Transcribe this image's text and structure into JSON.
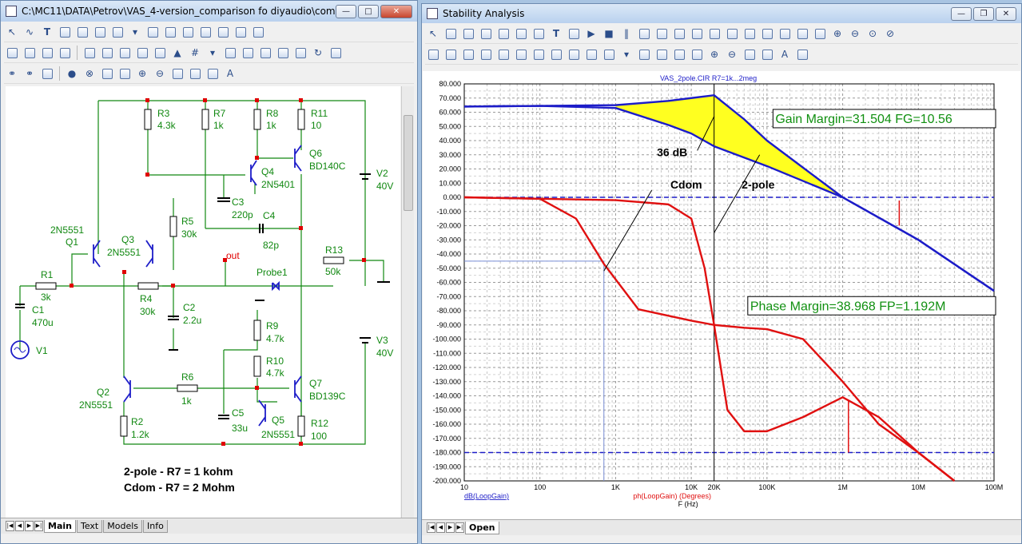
{
  "schematic_window": {
    "title": "C:\\MC11\\DATA\\Petrov\\VAS_4-version_comparison fo diyaudio\\compari...",
    "tabs": [
      "Main",
      "Text",
      "Models",
      "Info"
    ],
    "note_line1": "2-pole - R7 = 1 kohm",
    "note_line2": "Cdom - R7 = 2 Mohm",
    "components": {
      "R3": [
        "R3",
        "4.3k"
      ],
      "R7": [
        "R7",
        "1k"
      ],
      "R8": [
        "R8",
        "1k"
      ],
      "R11": [
        "R11",
        "10"
      ],
      "Q6": [
        "Q6",
        "BD140C"
      ],
      "Q4": [
        "Q4",
        "2N5401"
      ],
      "C3": [
        "C3",
        "220p"
      ],
      "C4": [
        "C4",
        "82p"
      ],
      "V2": [
        "V2",
        "40V"
      ],
      "R5": [
        "R5",
        "30k"
      ],
      "Q1": [
        "2N5551",
        "Q1"
      ],
      "Q3": [
        "Q3",
        "2N5551"
      ],
      "R13": [
        "R13",
        "50k"
      ],
      "out": "out",
      "Probe1": "Probe1",
      "R1": [
        "R1",
        "3k"
      ],
      "C1": [
        "C1",
        "470u"
      ],
      "R4": [
        "R4",
        "30k"
      ],
      "C2": [
        "C2",
        "2.2u"
      ],
      "V1": "V1",
      "R9": [
        "R9",
        "4.7k"
      ],
      "R10": [
        "R10",
        "4.7k"
      ],
      "V3": [
        "V3",
        "40V"
      ],
      "R6": [
        "R6",
        "1k"
      ],
      "Q7": [
        "Q7",
        "BD139C"
      ],
      "Q2": [
        "Q2",
        "2N5551"
      ],
      "R2": [
        "R2",
        "1.2k"
      ],
      "C5": [
        "C5",
        "33u"
      ],
      "Q5": [
        "Q5",
        "2N5551"
      ],
      "R12": [
        "R12",
        "100"
      ]
    }
  },
  "stability_window": {
    "title": "Stability Analysis",
    "tabs": [
      "Open"
    ],
    "plot_title": "VAS_2pole.CIR R7=1k...2meg",
    "gain_margin": "Gain Margin=31.504 FG=10.56",
    "phase_margin": "Phase Margin=38.968 FP=1.192M",
    "ann_36db": "36 dB",
    "ann_cdom": "Cdom",
    "ann_2pole": "2-pole",
    "legend_db": "dB(LoopGain)",
    "legend_ph": "ph(LoopGain) (Degrees)",
    "x_axis_label": "F (Hz)"
  },
  "chart_data": {
    "type": "line",
    "x_scale": "log",
    "xlim": [
      10,
      100000000
    ],
    "x_ticks": [
      "10",
      "100",
      "1K",
      "10K",
      "20K",
      "100K",
      "1M",
      "10M",
      "100M"
    ],
    "ylim": [
      -200,
      80
    ],
    "y_ticks": [
      "80.000",
      "70.000",
      "60.000",
      "50.000",
      "40.000",
      "30.000",
      "20.000",
      "10.000",
      "0.000",
      "-10.000",
      "-20.000",
      "-30.000",
      "-40.000",
      "-50.000",
      "-60.000",
      "-70.000",
      "-80.000",
      "-90.000",
      "-100.000",
      "-110.000",
      "-120.000",
      "-130.000",
      "-140.000",
      "-150.000",
      "-160.000",
      "-170.000",
      "-180.000",
      "-190.000",
      "-200.000"
    ],
    "series": [
      {
        "name": "dB(LoopGain) 2-pole",
        "color": "#1c1cc8",
        "x": [
          10,
          100,
          1000,
          5000,
          10000,
          20000,
          50000,
          100000,
          1000000,
          10000000,
          100000000
        ],
        "y": [
          64,
          64.5,
          65,
          68,
          70,
          72,
          55,
          40,
          0,
          -30,
          -66
        ]
      },
      {
        "name": "dB(LoopGain) Cdom",
        "color": "#1c1cc8",
        "x": [
          10,
          100,
          1000,
          5000,
          10000,
          20000,
          100000,
          1000000,
          10000000,
          100000000
        ],
        "y": [
          64,
          64.5,
          63,
          51,
          45,
          36,
          22,
          0,
          -30,
          -66
        ]
      },
      {
        "name": "ph(LoopGain) Cdom",
        "color": "#e01010",
        "x": [
          10,
          100,
          300,
          700,
          2000,
          10000,
          20000,
          50000,
          100000,
          300000,
          1000000,
          3000000,
          10000000,
          30000000
        ],
        "y": [
          0,
          -1,
          -15,
          -47,
          -79,
          -87,
          -90,
          -92,
          -93,
          -100,
          -130,
          -160,
          -180,
          -200
        ]
      },
      {
        "name": "ph(LoopGain) 2-pole",
        "color": "#e01010",
        "x": [
          10,
          100,
          1000,
          5000,
          10000,
          15000,
          20000,
          30000,
          50000,
          100000,
          300000,
          1000000,
          3000000,
          10000000,
          30000000
        ],
        "y": [
          0,
          -1,
          -2,
          -5,
          -15,
          -50,
          -90,
          -150,
          -165,
          -165,
          -155,
          -141,
          -155,
          -180,
          -200
        ]
      }
    ],
    "markers": {
      "zero_db_line": 0,
      "minus180_line": -180,
      "fg_hz": 10560,
      "fp_hz": 1192000,
      "cross_20k_hz": 20000
    },
    "grid": true
  }
}
